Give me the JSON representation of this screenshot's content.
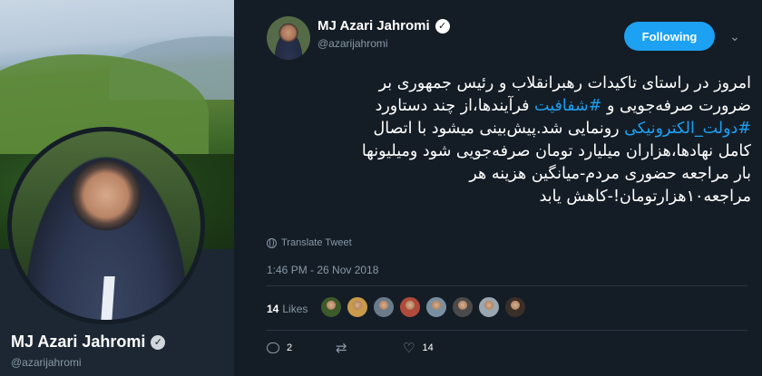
{
  "profile": {
    "name": "MJ Azari Jahromi",
    "handle": "@azarijahromi"
  },
  "tweet": {
    "author_name": "MJ Azari Jahromi",
    "author_handle": "@azarijahromi",
    "follow_label": "Following",
    "lines": [
      "امروز در راستای تاکیدات رهبرانقلاب و رئیس جمهوری بر",
      [
        "ضرورت صرفه‌جویی و ",
        "#شفافیت",
        " فرآیندها،از چند دستاورد"
      ],
      [
        "#دولت_الکترونیکی",
        " رونمایی شد.پیش‌بینی میشود با اتصال"
      ],
      "کامل نهادها،هزاران میلیارد تومان صرفه‌جویی شود ومیلیونها",
      "بار مراجعه حضوری مردم-میانگین هزینه هر",
      "مراجعه۱۰هزارتومان!-کاهش یابد"
    ],
    "translate_label": "Translate Tweet",
    "timestamp": "1:46 PM - 26 Nov 2018",
    "likes_count": "14",
    "likes_label": "Likes",
    "replies_count": "2",
    "retweets_count": "",
    "favorites_count": "14"
  },
  "colors": {
    "background": "#141d26",
    "accent": "#1da1f2",
    "muted_text": "#8899a6"
  },
  "likers": [
    {
      "icon": "liker-avatar-1",
      "color": "#3d5a2a"
    },
    {
      "icon": "liker-avatar-2",
      "color": "#c99a4a"
    },
    {
      "icon": "liker-avatar-3",
      "color": "#6a7c8c"
    },
    {
      "icon": "liker-avatar-4",
      "color": "#b04a3a"
    },
    {
      "icon": "liker-avatar-5",
      "color": "#7a8fa0"
    },
    {
      "icon": "liker-avatar-6",
      "color": "#4a4a4a"
    },
    {
      "icon": "liker-avatar-7",
      "color": "#9aa6b0"
    },
    {
      "icon": "liker-avatar-8",
      "color": "#3a2e28"
    }
  ]
}
